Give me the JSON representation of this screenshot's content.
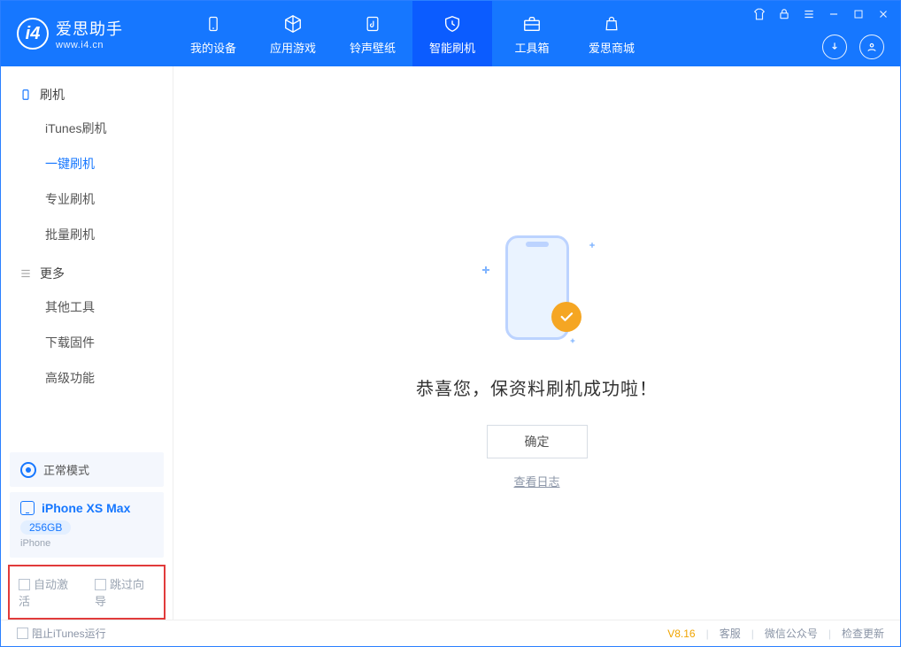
{
  "app": {
    "title": "爱思助手",
    "subtitle": "www.i4.cn"
  },
  "nav": {
    "tabs": [
      {
        "label": "我的设备",
        "icon": "device"
      },
      {
        "label": "应用游戏",
        "icon": "cube"
      },
      {
        "label": "铃声壁纸",
        "icon": "music"
      },
      {
        "label": "智能刷机",
        "icon": "shield",
        "active": true
      },
      {
        "label": "工具箱",
        "icon": "toolbox"
      },
      {
        "label": "爱思商城",
        "icon": "bag"
      }
    ]
  },
  "sidebar": {
    "group1": {
      "title": "刷机",
      "items": [
        "iTunes刷机",
        "一键刷机",
        "专业刷机",
        "批量刷机"
      ],
      "active_index": 1
    },
    "group2": {
      "title": "更多",
      "items": [
        "其他工具",
        "下载固件",
        "高级功能"
      ]
    },
    "mode": "正常模式",
    "device": {
      "name": "iPhone XS Max",
      "storage": "256GB",
      "type": "iPhone"
    },
    "options": {
      "auto_activate": "自动激活",
      "skip_guide": "跳过向导"
    }
  },
  "main": {
    "result_text": "恭喜您，保资料刷机成功啦！",
    "ok_button": "确定",
    "view_log": "查看日志"
  },
  "footer": {
    "block_itunes": "阻止iTunes运行",
    "version": "V8.16",
    "links": [
      "客服",
      "微信公众号",
      "检查更新"
    ]
  }
}
